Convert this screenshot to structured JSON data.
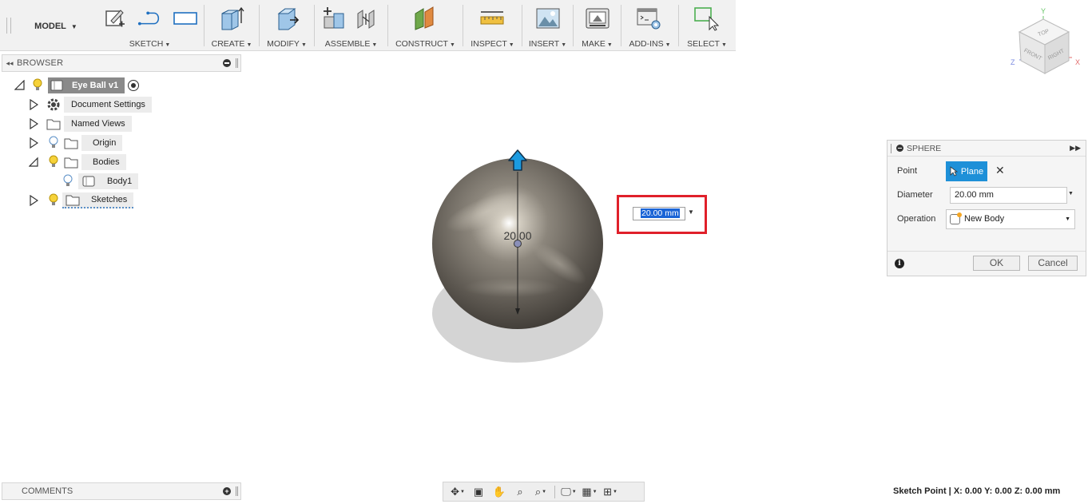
{
  "toolbar": {
    "workspace": "MODEL",
    "groups": {
      "sketch": "SKETCH",
      "create": "CREATE",
      "modify": "MODIFY",
      "assemble": "ASSEMBLE",
      "construct": "CONSTRUCT",
      "inspect": "INSPECT",
      "insert": "INSERT",
      "make": "MAKE",
      "addins": "ADD-INS",
      "select": "SELECT"
    }
  },
  "browser": {
    "title": "BROWSER",
    "root": "Eye Ball v1",
    "items": {
      "document_settings": "Document Settings",
      "named_views": "Named Views",
      "origin": "Origin",
      "bodies": "Bodies",
      "body1": "Body1",
      "sketches": "Sketches"
    }
  },
  "viewport": {
    "dimension_label": "20.00",
    "dimension_input": "20.00 mm"
  },
  "viewcube": {
    "top": "TOP",
    "front": "FRONT",
    "right": "RIGHT",
    "axis_x": "X",
    "axis_y": "Y",
    "axis_z": "Z"
  },
  "sphere_dialog": {
    "title": "SPHERE",
    "point_label": "Point",
    "point_value": "Plane",
    "diameter_label": "Diameter",
    "diameter_value": "20.00 mm",
    "operation_label": "Operation",
    "operation_value": "New Body",
    "ok": "OK",
    "cancel": "Cancel"
  },
  "comments": {
    "title": "COMMENTS"
  },
  "status": {
    "text": "Sketch Point | X: 0.00 Y: 0.00 Z: 0.00 mm"
  },
  "colors": {
    "accent": "#1e90d8",
    "highlight_box": "#e0202a",
    "selection": "#1a64d6"
  }
}
